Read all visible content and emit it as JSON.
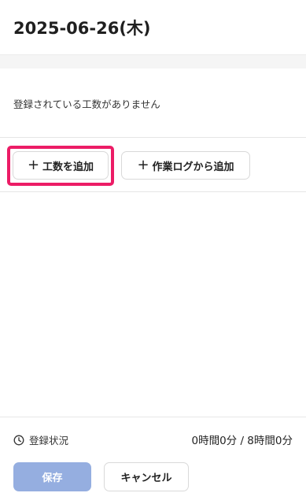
{
  "header": {
    "date": "2025-06-26(木)"
  },
  "main": {
    "empty_message": "登録されている工数がありません",
    "add_button": {
      "plus": "+",
      "label": "工数を追加"
    },
    "add_from_log_button": {
      "plus": "+",
      "label": "作業ログから追加"
    }
  },
  "footer": {
    "status_label": "登録状況",
    "hours_summary": "0時間0分 / 8時間0分",
    "save_label": "保存",
    "cancel_label": "キャンセル"
  },
  "colors": {
    "highlight": "#ec1c66",
    "save_disabled": "#95aee0"
  },
  "icons": {
    "status": "clock-icon",
    "add": "plus-icon"
  }
}
